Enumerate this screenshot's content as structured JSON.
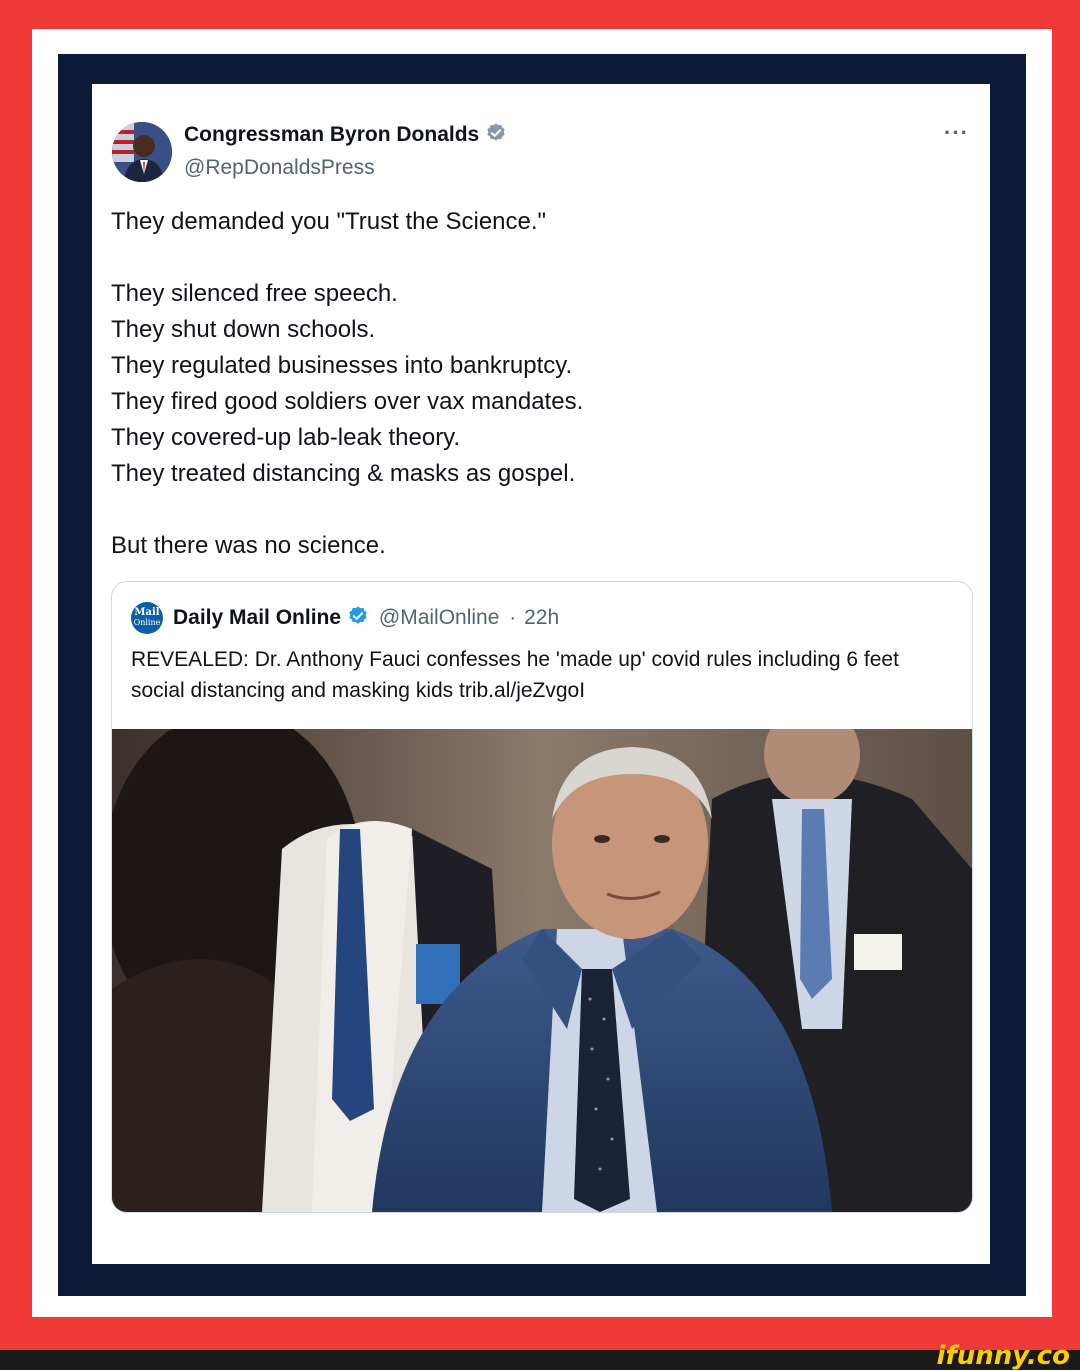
{
  "colors": {
    "outer_frame": "#f03a37",
    "inner_frame": "#0e1b38",
    "verified_blue": "#1d9bf0",
    "verified_gray": "#829aab",
    "text_primary": "#0f1419",
    "text_secondary": "#536471",
    "watermark": "#ffcc00"
  },
  "tweet": {
    "author_name": "Congressman Byron Donalds",
    "handle": "@RepDonaldsPress",
    "more_icon": "more-options-icon",
    "lines": {
      "l1": "They demanded you \"Trust the Science.\"",
      "l2": "They silenced free speech.",
      "l3": "They shut down schools.",
      "l4": "They regulated businesses into bankruptcy.",
      "l5": "They fired good soldiers over vax mandates.",
      "l6": "They covered-up lab-leak theory.",
      "l7": "They treated distancing & masks as gospel.",
      "l8": "But there was no science."
    }
  },
  "quoted_tweet": {
    "avatar_text_top": "Mail",
    "avatar_text_bottom": "Online",
    "name": "Daily Mail Online",
    "handle": "@MailOnline",
    "separator": "·",
    "time": "22h",
    "text": "REVEALED: Dr. Anthony Fauci confesses he 'made up' covid rules including 6 feet social distancing and masking kids trib.al/jeZvgoI"
  },
  "watermark": {
    "text": "ifunny.co"
  }
}
